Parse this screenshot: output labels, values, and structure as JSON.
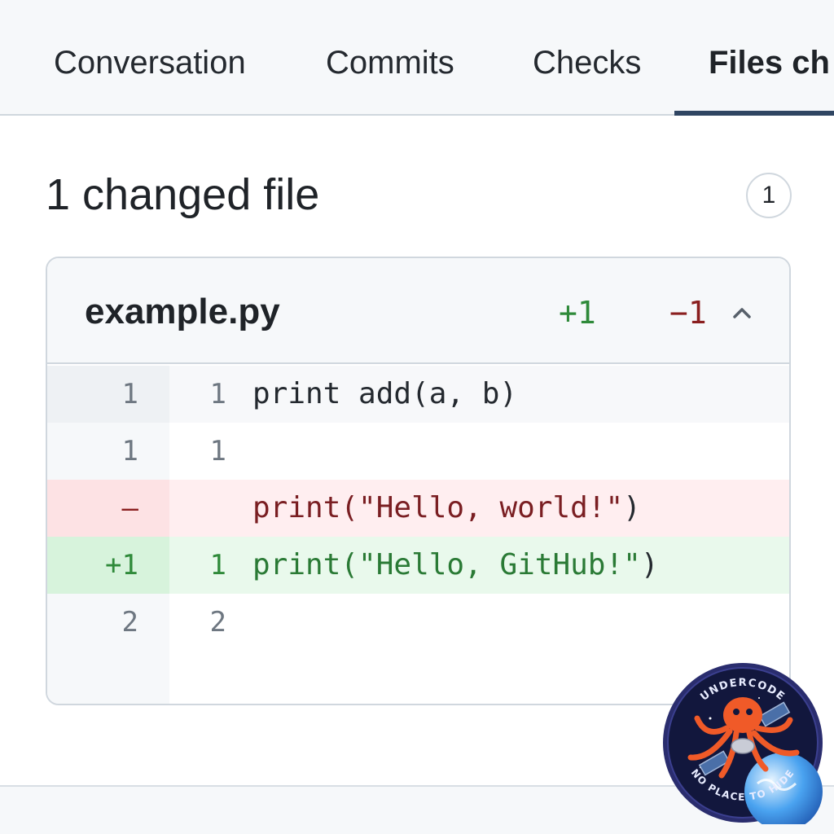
{
  "tabs": [
    {
      "label": "Conversation"
    },
    {
      "label": "Commits"
    },
    {
      "label": "Checks"
    },
    {
      "label": "Files ch",
      "active": true
    }
  ],
  "summary": {
    "title": "1 changed  file",
    "count_badge": "1"
  },
  "file": {
    "name": "example.py",
    "additions": "+1",
    "deletions": "−1",
    "collapse_icon": "chevron-up-icon"
  },
  "diff_rows": [
    {
      "type": "context",
      "old": "1",
      "new": "1",
      "code": "print add(a, b)"
    },
    {
      "type": "context",
      "old": "1",
      "new": "1",
      "code": ""
    },
    {
      "type": "deletion",
      "old": "–",
      "new": "",
      "code_open": "print(",
      "code_str": "\"Hello, world!\"",
      "code_close": ")"
    },
    {
      "type": "addition",
      "old": "+1",
      "new": "1",
      "code_open": "print(",
      "code_str": "\"Hello, GitHub!\"",
      "code_close": ")"
    },
    {
      "type": "context",
      "old": "2",
      "new": "2",
      "code": ""
    }
  ],
  "logo": {
    "top_text": "UNDERCODE",
    "bottom_text": "NO PLACE TO HIDE"
  },
  "colors": {
    "addition": "#2f8a3a",
    "deletion": "#8a1f1f",
    "active_tab_underline": "#2f4562"
  }
}
